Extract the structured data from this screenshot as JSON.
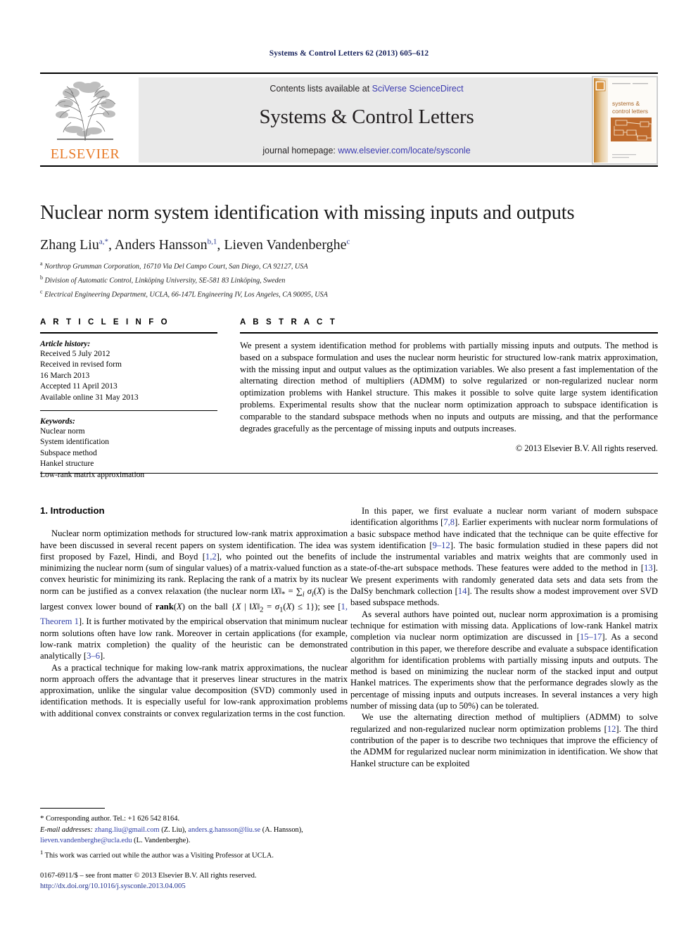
{
  "running_head": "Systems & Control Letters 62 (2013) 605–612",
  "masthead": {
    "publisher_name": "ELSEVIER",
    "contents_prefix": "Contents lists available at ",
    "contents_link": "SciVerse ScienceDirect",
    "journal_title": "Systems & Control Letters",
    "homepage_prefix": "journal homepage: ",
    "homepage_link": "www.elsevier.com/locate/sysconle",
    "cover_title_line1": "systems &",
    "cover_title_line2": "control letters",
    "link_color": "#3b3bb0",
    "logo_color": "#e87a27"
  },
  "article": {
    "title": "Nuclear norm system identification with missing inputs and outputs",
    "authors_html": "Zhang Liu<sup>a,*</sup>, Anders Hansson<sup>b,1</sup>, Lieven Vandenberghe<sup>c</sup>",
    "affiliations": [
      {
        "mark": "a",
        "text": "Northrop Grumman Corporation, 16710 Via Del Campo Court, San Diego, CA 92127, USA"
      },
      {
        "mark": "b",
        "text": "Division of Automatic Control, Linköping University, SE-581 83 Linköping, Sweden"
      },
      {
        "mark": "c",
        "text": "Electrical Engineering Department, UCLA, 66-147L Engineering IV, Los Angeles, CA 90095, USA"
      }
    ]
  },
  "article_info": {
    "heading": "A R T I C L E    I N F O",
    "history_label": "Article history:",
    "history": [
      "Received 5 July 2012",
      "Received in revised form",
      "16 March 2013",
      "Accepted 11 April 2013",
      "Available online 31 May 2013"
    ],
    "keywords_label": "Keywords:",
    "keywords": [
      "Nuclear norm",
      "System identification",
      "Subspace method",
      "Hankel structure",
      "Low-rank matrix approximation"
    ]
  },
  "abstract": {
    "heading": "A B S T R A C T",
    "text": "We present a system identification method for problems with partially missing inputs and outputs. The method is based on a subspace formulation and uses the nuclear norm heuristic for structured low-rank matrix approximation, with the missing input and output values as the optimization variables. We also present a fast implementation of the alternating direction method of multipliers (ADMM) to solve regularized or non-regularized nuclear norm optimization problems with Hankel structure. This makes it possible to solve quite large system identification problems. Experimental results show that the nuclear norm optimization approach to subspace identification is comparable to the standard subspace methods when no inputs and outputs are missing, and that the performance degrades gracefully as the percentage of missing inputs and outputs increases.",
    "copyright": "© 2013 Elsevier B.V. All rights reserved."
  },
  "body": {
    "section_heading": "1. Introduction",
    "left_paragraphs": [
      "Nuclear norm optimization methods for structured low-rank matrix approximation have been discussed in several recent papers on system identification. The idea was first proposed by Fazel, Hindi, and Boyd [1,2], who pointed out the benefits of minimizing the nuclear norm (sum of singular values) of a matrix-valued function as a convex heuristic for minimizing its rank. Replacing the rank of a matrix by its nuclear norm can be justified as a convex relaxation (the nuclear norm ‖X‖* = ∑i σi(X) is the largest convex lower bound of rank(X) on the ball {X | ‖X‖2 = σ1(X) ≤ 1}); see [1, Theorem 1]. It is further motivated by the empirical observation that minimum nuclear norm solutions often have low rank. Moreover in certain applications (for example, low-rank matrix completion) the quality of the heuristic can be demonstrated analytically [3–6].",
      "As a practical technique for making low-rank matrix approximations, the nuclear norm approach offers the advantage that it preserves linear structures in the matrix approximation, unlike the singular value decomposition (SVD) commonly used in identification methods. It is especially useful for low-rank approximation problems with additional convex constraints or convex regularization terms in the cost function."
    ],
    "right_paragraphs": [
      "In this paper, we first evaluate a nuclear norm variant of modern subspace identification algorithms [7,8]. Earlier experiments with nuclear norm formulations of a basic subspace method have indicated that the technique can be quite effective for system identification [9–12]. The basic formulation studied in these papers did not include the instrumental variables and matrix weights that are commonly used in state-of-the-art subspace methods. These features were added to the method in [13]. We present experiments with randomly generated data sets and data sets from the DaISy benchmark collection [14]. The results show a modest improvement over SVD based subspace methods.",
      "As several authors have pointed out, nuclear norm approximation is a promising technique for estimation with missing data. Applications of low-rank Hankel matrix completion via nuclear norm optimization are discussed in [15–17]. As a second contribution in this paper, we therefore describe and evaluate a subspace identification algorithm for identification problems with partially missing inputs and outputs. The method is based on minimizing the nuclear norm of the stacked input and output Hankel matrices. The experiments show that the performance degrades slowly as the percentage of missing inputs and outputs increases. In several instances a very high number of missing data (up to 50%) can be tolerated.",
      "We use the alternating direction method of multipliers (ADMM) to solve regularized and non-regularized nuclear norm optimization problems [12]. The third contribution of the paper is to describe two techniques that improve the efficiency of the ADMM for regularized nuclear norm minimization in identification. We show that Hankel structure can be exploited"
    ]
  },
  "footnotes": {
    "corresponding": "Corresponding author. Tel.: +1 626 542 8164.",
    "email_label": "E-mail addresses:",
    "email1": "zhang.liu@gmail.com",
    "email1_owner": "(Z. Liu),",
    "email2": "anders.g.hansson@liu.se",
    "email2_owner": "(A. Hansson),",
    "email3": "lieven.vandenberghe@ucla.edu",
    "email3_owner": "(L. Vandenberghe).",
    "note1": "This work was carried out while the author was a Visiting Professor at UCLA."
  },
  "imprint": {
    "line1": "0167-6911/$ – see front matter © 2013 Elsevier B.V. All rights reserved.",
    "doi": "http://dx.doi.org/10.1016/j.sysconle.2013.04.005"
  }
}
